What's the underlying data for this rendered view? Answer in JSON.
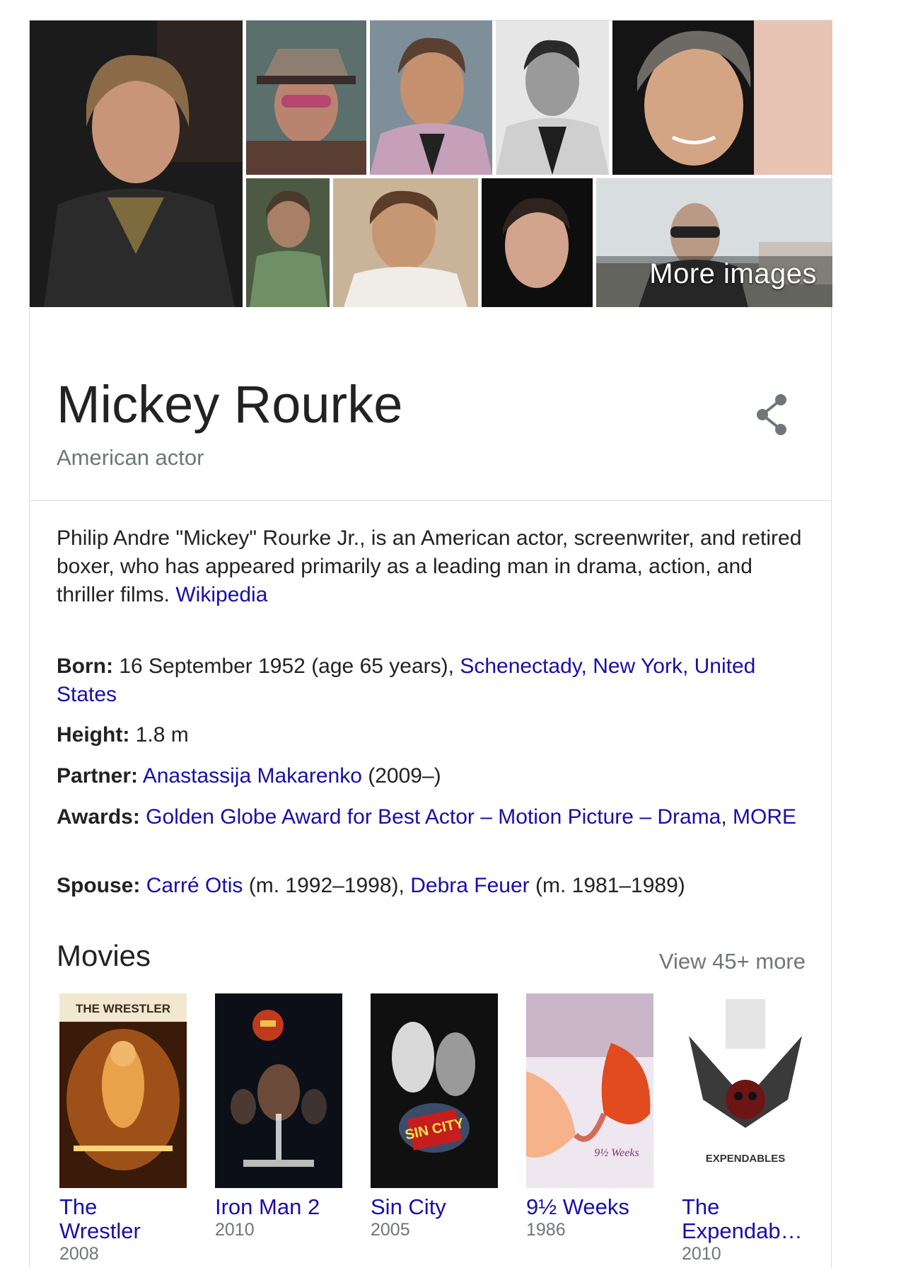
{
  "images": {
    "more_label": "More images"
  },
  "entity": {
    "name": "Mickey Rourke",
    "subtitle": "American actor"
  },
  "description": {
    "text": "Philip Andre \"Mickey\" Rourke Jr., is an American actor, screenwriter, and retired boxer, who has appeared primarily as a leading man in drama, action, and thriller films.",
    "source": "Wikipedia"
  },
  "facts": {
    "born": {
      "label": "Born:",
      "text": "16 September 1952 (age 65 years),",
      "link": "Schenectady, New York, United States"
    },
    "height": {
      "label": "Height:",
      "text": "1.8 m"
    },
    "partner": {
      "label": "Partner:",
      "link": "Anastassija Makarenko",
      "text": "(2009–)"
    },
    "awards": {
      "label": "Awards:",
      "link": "Golden Globe Award for Best Actor – Motion Picture – Drama",
      "sep": ",",
      "more": "MORE"
    },
    "spouse": {
      "label": "Spouse:",
      "link1": "Carré Otis",
      "text1": "(m. 1992–1998),",
      "link2": "Debra Feuer",
      "text2": "(m. 1981–1989)"
    }
  },
  "movies": {
    "title": "Movies",
    "view_more": "View 45+ more",
    "items": [
      {
        "title_line1": "The",
        "title_line2": "Wrestler",
        "year": "2008",
        "poster_text": "THE WRESTLER"
      },
      {
        "title_line1": "Iron Man 2",
        "title_line2": "",
        "year": "2010",
        "poster_text": ""
      },
      {
        "title_line1": "Sin City",
        "title_line2": "",
        "year": "2005",
        "poster_text": "SIN CITY"
      },
      {
        "title_line1": "9½ Weeks",
        "title_line2": "",
        "year": "1986",
        "poster_text": "9½ Weeks"
      },
      {
        "title_line1": "The",
        "title_line2": "Expendab…",
        "year": "2010",
        "poster_text": "EXPENDABLES"
      }
    ]
  }
}
